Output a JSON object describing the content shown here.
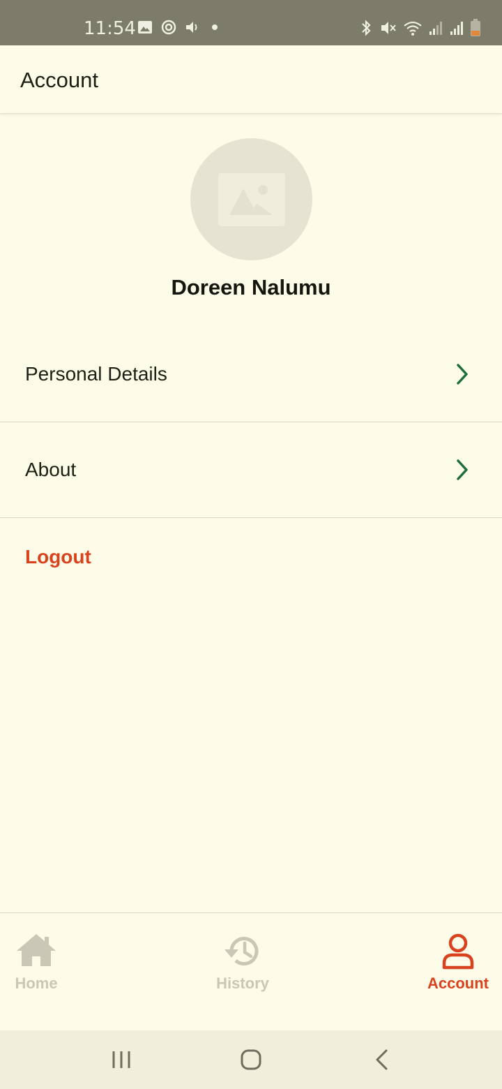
{
  "status_bar": {
    "time": "11:54",
    "left_icons": [
      "image-icon",
      "sync-icon",
      "volume-icon",
      "dot-icon"
    ],
    "right_icons": [
      "bluetooth-icon",
      "mute-icon",
      "wifi-icon",
      "signal-icon",
      "signal-icon",
      "battery-icon"
    ]
  },
  "app_bar": {
    "title": "Account"
  },
  "profile": {
    "avatar_icon": "image-placeholder-icon",
    "name": "Doreen Nalumu"
  },
  "menu": {
    "items": [
      {
        "label": "Personal Details",
        "icon": "chevron-right-icon"
      },
      {
        "label": "About",
        "icon": "chevron-right-icon"
      }
    ],
    "logout_label": "Logout"
  },
  "bottom_nav": {
    "items": [
      {
        "label": "Home",
        "icon": "home-icon",
        "active": false
      },
      {
        "label": "History",
        "icon": "history-icon",
        "active": false
      },
      {
        "label": "Account",
        "icon": "person-icon",
        "active": true
      }
    ]
  },
  "colors": {
    "background": "#fdfce8",
    "accent": "#d8421f",
    "chevron": "#1f6e3a",
    "inactive": "#c9c8b6",
    "status_bar": "#7d7c6a"
  }
}
